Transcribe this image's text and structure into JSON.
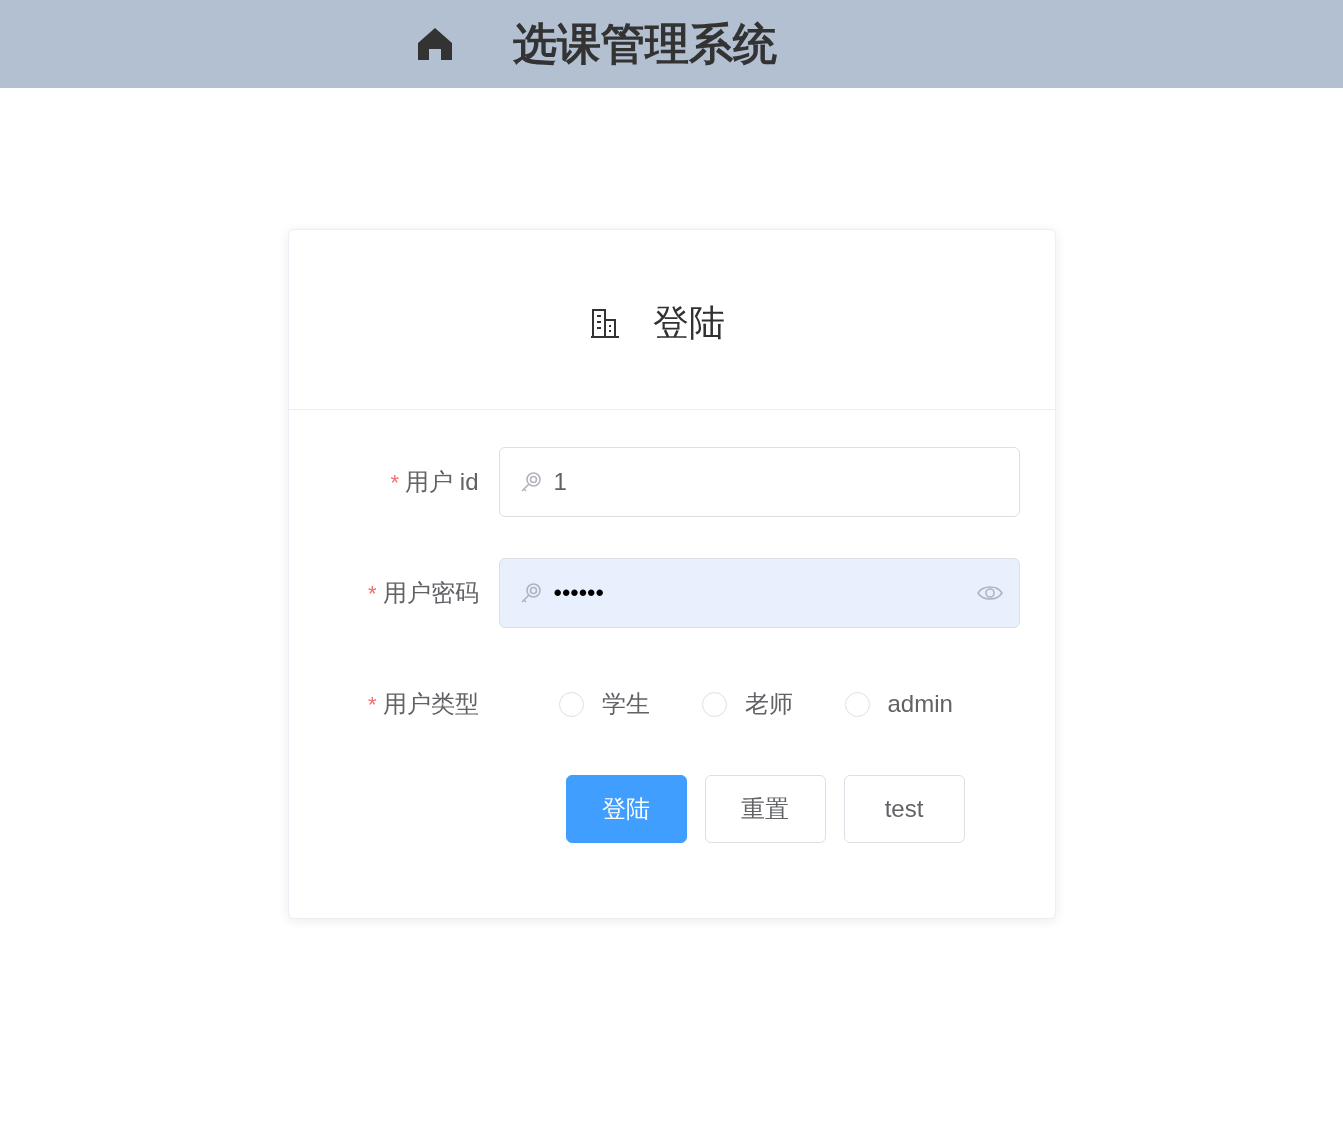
{
  "header": {
    "title": "选课管理系统"
  },
  "card": {
    "title": "登陆"
  },
  "form": {
    "fields": [
      {
        "kind": "text",
        "mark": "*",
        "label": "用户 id",
        "value": "1"
      },
      {
        "kind": "password",
        "mark": "*",
        "label": "用户密码",
        "value": "••••••"
      },
      {
        "kind": "radio",
        "mark": "*",
        "label": "用户类型",
        "options": [
          {
            "label": "学生",
            "selected": false
          },
          {
            "label": "老师",
            "selected": false
          },
          {
            "label": "admin",
            "selected": false
          }
        ]
      }
    ],
    "buttons": [
      {
        "label": "登陆",
        "primary": true
      },
      {
        "label": "重置",
        "primary": false
      },
      {
        "label": "test",
        "primary": false
      }
    ]
  }
}
